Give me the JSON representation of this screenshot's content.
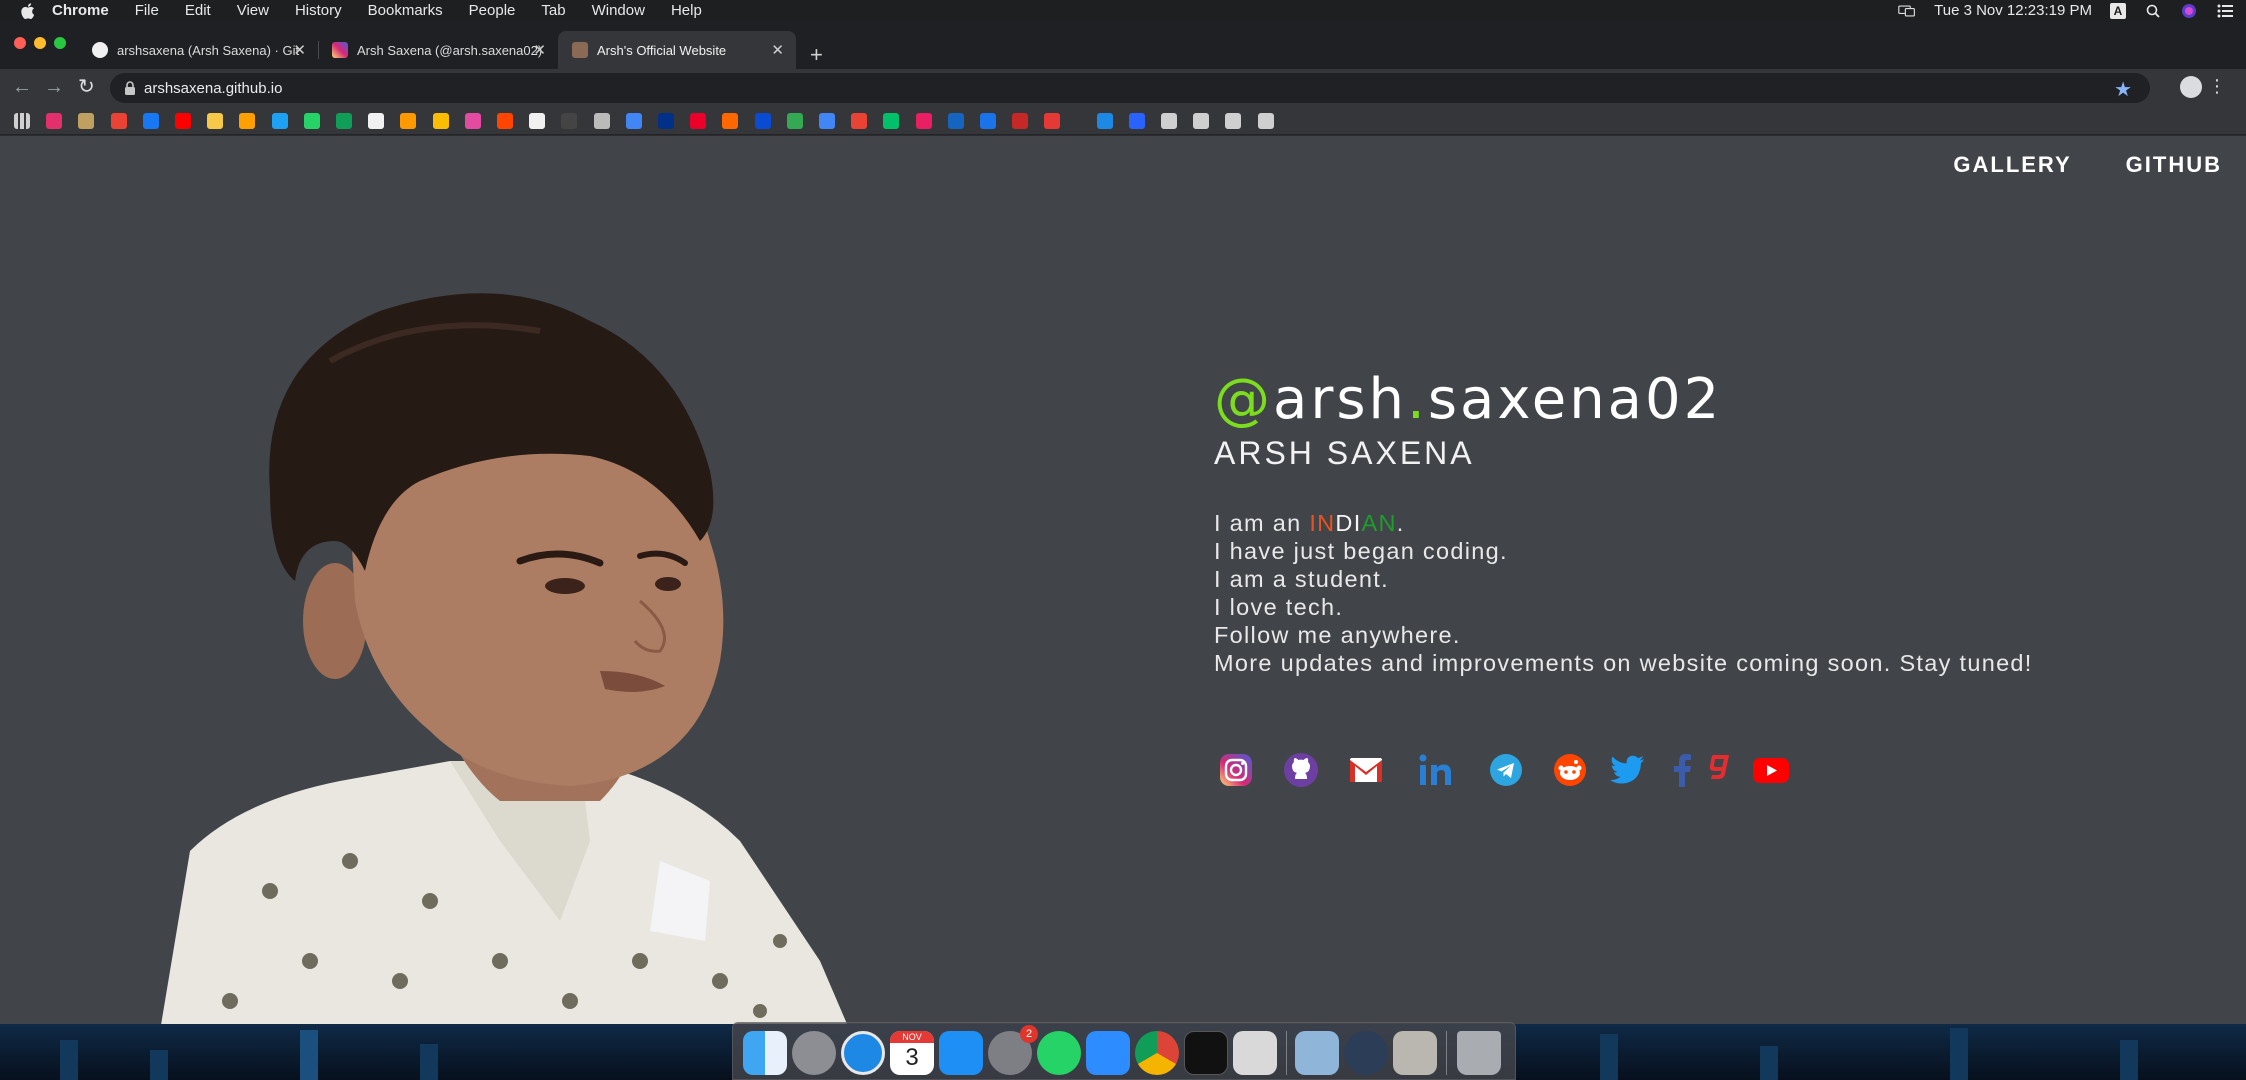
{
  "menubar": {
    "items": [
      "Chrome",
      "File",
      "Edit",
      "View",
      "History",
      "Bookmarks",
      "People",
      "Tab",
      "Window",
      "Help"
    ],
    "clock": "Tue 3 Nov  12:23:19 PM",
    "input_source": "A"
  },
  "tabs": [
    {
      "title": "arshsaxena (Arsh Saxena) · Git",
      "favicon": "github-icon",
      "active": false
    },
    {
      "title": "Arsh Saxena (@arsh.saxena02)",
      "favicon": "instagram-icon",
      "active": false
    },
    {
      "title": "Arsh's Official Website",
      "favicon": "site-icon",
      "active": true
    }
  ],
  "omnibox": {
    "url": "arshsaxena.github.io"
  },
  "bookmarks": [
    "apps-icon",
    "instagram-icon",
    "bookmark-icon",
    "gmail-icon",
    "facebook-icon",
    "youtube-icon",
    "flipkart-icon",
    "firebase-icon",
    "twitter-icon",
    "whatsapp-icon",
    "sheets-icon",
    "wikipedia-icon",
    "amazon-icon",
    "keep-icon",
    "medium-icon",
    "reddit-icon",
    "github-icon",
    "behance-icon",
    "apple-icon",
    "google-icon",
    "paypal-icon",
    "oneplus-icon",
    "mi-icon",
    "jio-icon",
    "maps-icon",
    "translate-icon",
    "photos-icon",
    "play-icon",
    "myntra-icon",
    "pinterest-icon",
    "indianrail-icon",
    "mytoday-icon",
    "gaana-icon",
    "aws-icon",
    "clapper-icon",
    "history-icon",
    "downloads-icon",
    "star-icon",
    "settings-icon"
  ],
  "site": {
    "nav": {
      "gallery": "GALLERY",
      "github": "GITHUB"
    },
    "handle": {
      "at": "@",
      "first": "arsh",
      "dot": ".",
      "rest": "saxena02"
    },
    "name": "ARSH SAXENA",
    "bio": {
      "line1_prefix": "I am an ",
      "indian": {
        "part1": "IN",
        "part2": "DI",
        "part3": "AN"
      },
      "line1_suffix": ".",
      "line2": "I have just began coding.",
      "line3": "I am a student.",
      "line4": "I love tech.",
      "line5": "Follow me anywhere.",
      "line6": "More updates and improvements on website coming soon. Stay tuned!"
    },
    "socials": [
      "instagram-icon",
      "github-icon",
      "gmail-icon",
      "linkedin-icon",
      "telegram-icon",
      "reddit-icon",
      "twitter-icon",
      "facebook-icon",
      "gaana-icon",
      "youtube-icon"
    ],
    "colors": {
      "background": "#41454a",
      "accent": "#7cdc1e",
      "indian_saffron": "#e8541f",
      "indian_green": "#1f9d2a"
    }
  },
  "dock": {
    "apps": [
      "finder",
      "launchpad",
      "safari",
      "calendar",
      "app-store",
      "system-preferences",
      "whatsapp",
      "zoom",
      "chrome",
      "activity-monitor",
      "screenshot",
      "preview",
      "quicktime",
      "font-book",
      "trash"
    ],
    "calendar_day": "3",
    "calendar_month": "NOV",
    "system_prefs_badge": "2"
  }
}
